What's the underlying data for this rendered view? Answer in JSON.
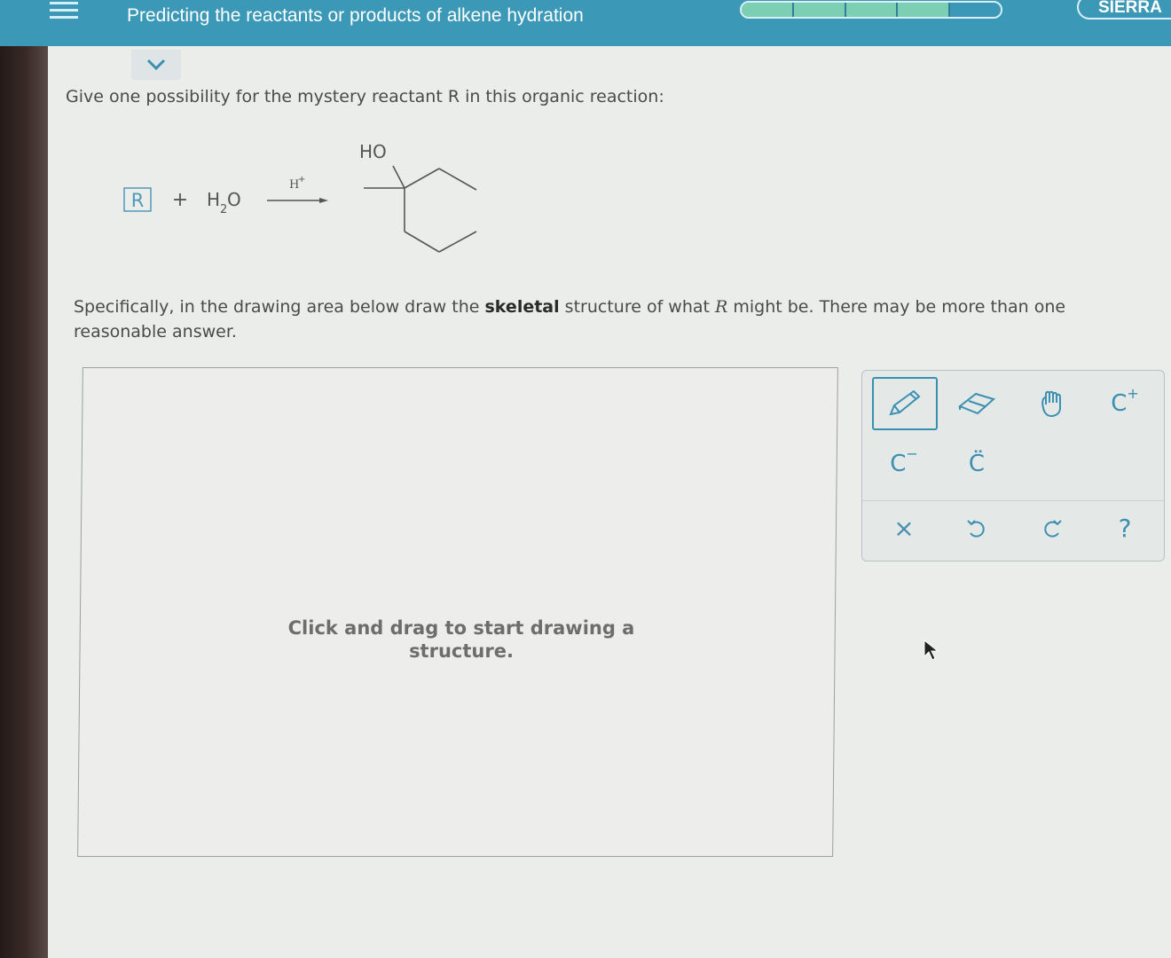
{
  "header": {
    "title": "Predicting the reactants or products of alkene hydration",
    "brand": "SIERRA",
    "progress": {
      "segments_total": 5,
      "segments_done": 4
    }
  },
  "question": {
    "prompt": "Give one possibility for the mystery reactant R in this organic reaction:",
    "instruction_pre": "Specifically, in the drawing area below draw the ",
    "instruction_bold": "skeletal",
    "instruction_mid": " structure of what ",
    "instruction_var": "R",
    "instruction_post": " might be. There may be more than one reasonable answer."
  },
  "reaction": {
    "reactant_box": "R",
    "plus": "+",
    "water": "H",
    "water_sub": "2",
    "water_end": "O",
    "catalyst": "H",
    "catalyst_sup": "+",
    "product_label": "HO"
  },
  "canvas": {
    "placeholder": "Click and drag to start drawing a structure."
  },
  "toolbox": {
    "pencil": "pencil-icon",
    "eraser": "eraser-icon",
    "hand": "hand-icon",
    "c_plus": "C",
    "c_plus_sup": "+",
    "c_minus": "C",
    "c_minus_sup": "−",
    "c_radical": "C̈",
    "clear": "×",
    "undo": "undo-icon",
    "redo": "redo-icon",
    "help": "?"
  },
  "colors": {
    "header": "#3b98b6",
    "accent": "#3b8fb0",
    "progress_fill": "#7ccfb2"
  }
}
